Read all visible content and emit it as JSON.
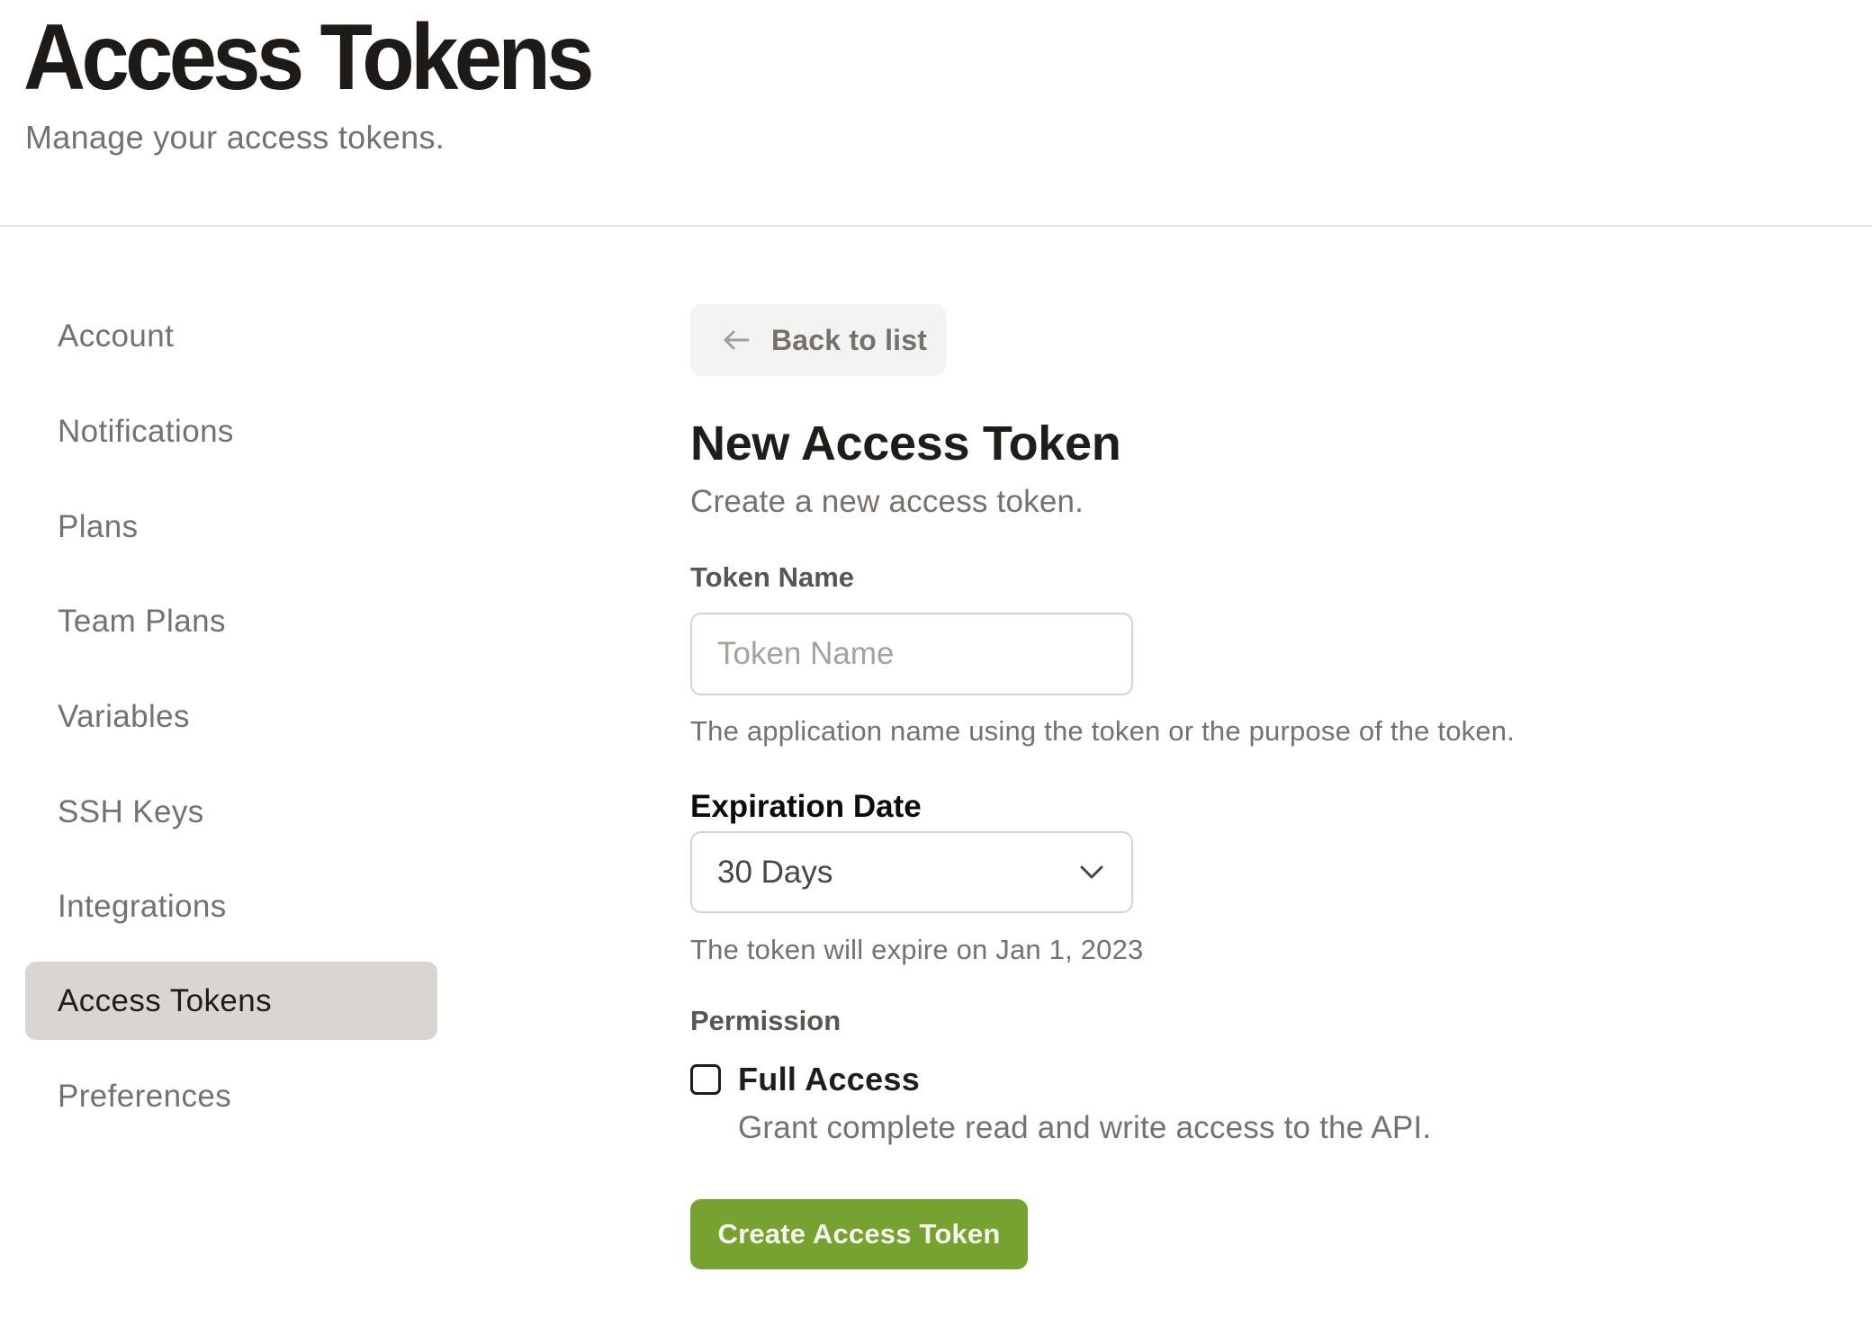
{
  "header": {
    "title": "Access Tokens",
    "subtitle": "Manage your access tokens."
  },
  "sidebar": {
    "active_index": 7,
    "items": [
      {
        "label": "Account"
      },
      {
        "label": "Notifications"
      },
      {
        "label": "Plans"
      },
      {
        "label": "Team Plans"
      },
      {
        "label": "Variables"
      },
      {
        "label": "SSH Keys"
      },
      {
        "label": "Integrations"
      },
      {
        "label": "Access Tokens"
      },
      {
        "label": "Preferences"
      }
    ]
  },
  "main": {
    "back_button": {
      "label": "Back to list",
      "icon": "arrow-left-icon"
    },
    "form_title": "New Access Token",
    "form_subtitle": "Create a new access token.",
    "token_name": {
      "label": "Token Name",
      "value": "",
      "placeholder": "Token Name",
      "helper": "The application name using the token or the purpose of the token."
    },
    "expiration": {
      "label": "Expiration Date",
      "selected": "30 Days",
      "icon": "chevron-down-icon",
      "helper": "The token will expire on Jan 1, 2023"
    },
    "permission": {
      "label": "Permission",
      "options": [
        {
          "label": "Full Access",
          "description": "Grant complete read and write access to the API.",
          "checked": false
        }
      ]
    },
    "submit_label": "Create Access Token"
  },
  "colors": {
    "accent_green": "#76a22f",
    "sidebar_active_bg": "#d9d5d2",
    "muted_text": "#77716d",
    "divider": "#e3e3e3"
  }
}
